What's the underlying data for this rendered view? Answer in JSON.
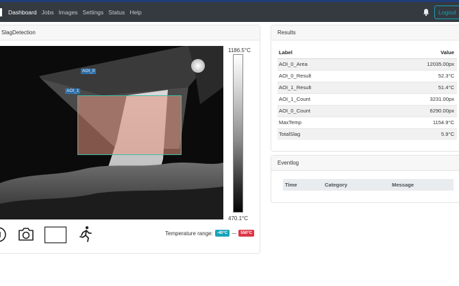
{
  "nav": {
    "items": [
      {
        "label": "Dashboard",
        "active": true
      },
      {
        "label": "Jobs"
      },
      {
        "label": "Images"
      },
      {
        "label": "Settings"
      },
      {
        "label": "Status"
      },
      {
        "label": "Help"
      }
    ],
    "logout_label": "Logout",
    "notification_icon": "bell-icon"
  },
  "camera_card": {
    "title": "SlagDetection",
    "aoi": [
      {
        "label": "AOI_0"
      },
      {
        "label": "AOI_1"
      }
    ],
    "scale_max": "1186.5°C",
    "scale_min": "470.1°C",
    "controls": [
      "stop-icon",
      "camera-icon",
      "rectangle-icon",
      "running-person-icon"
    ],
    "temperature_range_label": "Temperature range:",
    "range_min": "-40°C",
    "range_separator": "—",
    "range_max": "550°C"
  },
  "results_card": {
    "title": "Results",
    "columns": [
      "Label",
      "Value"
    ],
    "rows": [
      {
        "label": "AOI_0_Area",
        "value": "12035.00px"
      },
      {
        "label": "AOI_0_Result",
        "value": "52.3°C"
      },
      {
        "label": "AOI_1_Result",
        "value": "51.4°C"
      },
      {
        "label": "AOI_1_Count",
        "value": "3231.00px"
      },
      {
        "label": "AOI_0_Count",
        "value": "6290.00px"
      },
      {
        "label": "MaxTemp",
        "value": "1154.9°C"
      },
      {
        "label": "TotalSlag",
        "value": "5.9°C"
      }
    ]
  },
  "eventlog_card": {
    "title": "Eventlog",
    "columns": [
      "Time",
      "Category",
      "Message"
    ]
  },
  "colors": {
    "navbar": "#343a40",
    "accent_strip": "#1f3d7a",
    "info": "#17a2b8",
    "danger": "#dc3545",
    "aoi_label": "#2f6fa8",
    "aoi_border": "#3fbfa8"
  }
}
